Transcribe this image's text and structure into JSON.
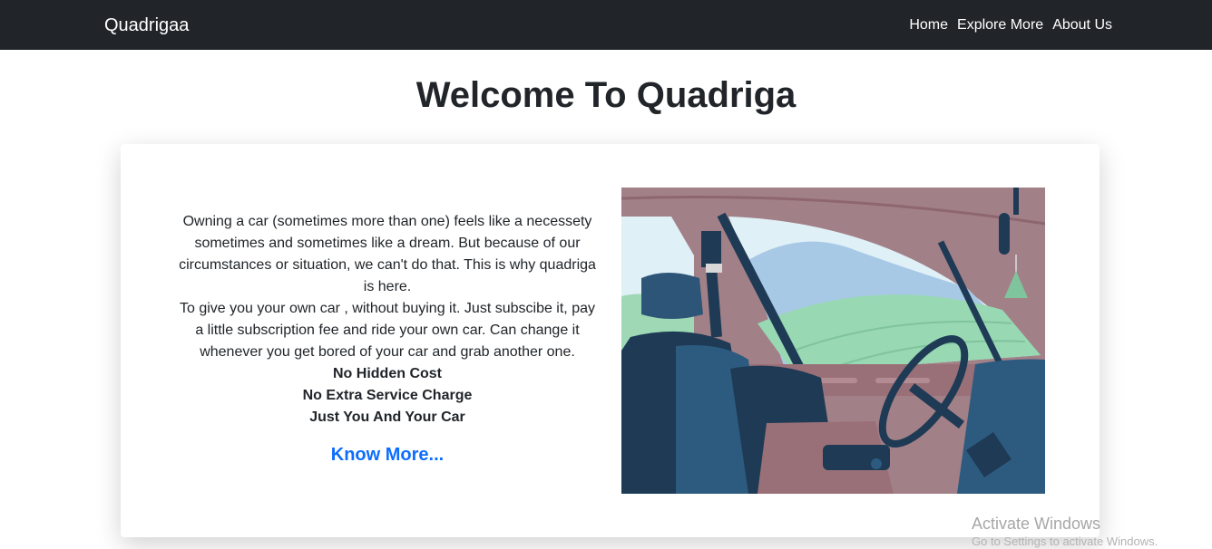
{
  "navbar": {
    "brand": "Quadrigaa",
    "links": [
      "Home",
      "Explore More",
      "About Us"
    ]
  },
  "page": {
    "title": "Welcome To Quadriga"
  },
  "card": {
    "paragraph1": "Owning a car (sometimes more than one) feels like a necessety sometimes and sometimes like a dream. But because of our circumstances or situation, we can't do that. This is why quadriga is here.",
    "paragraph2": "To give you your own car , without buying it. Just subscibe it, pay a little subscription fee and ride your own car. Can change it whenever you get bored of your car and grab another one.",
    "features": [
      "No Hidden Cost",
      "No Extra Service Charge",
      "Just You And Your Car"
    ],
    "cta": "Know More..."
  },
  "watermark": {
    "title": "Activate Windows",
    "subtitle": "Go to Settings to activate Windows."
  }
}
